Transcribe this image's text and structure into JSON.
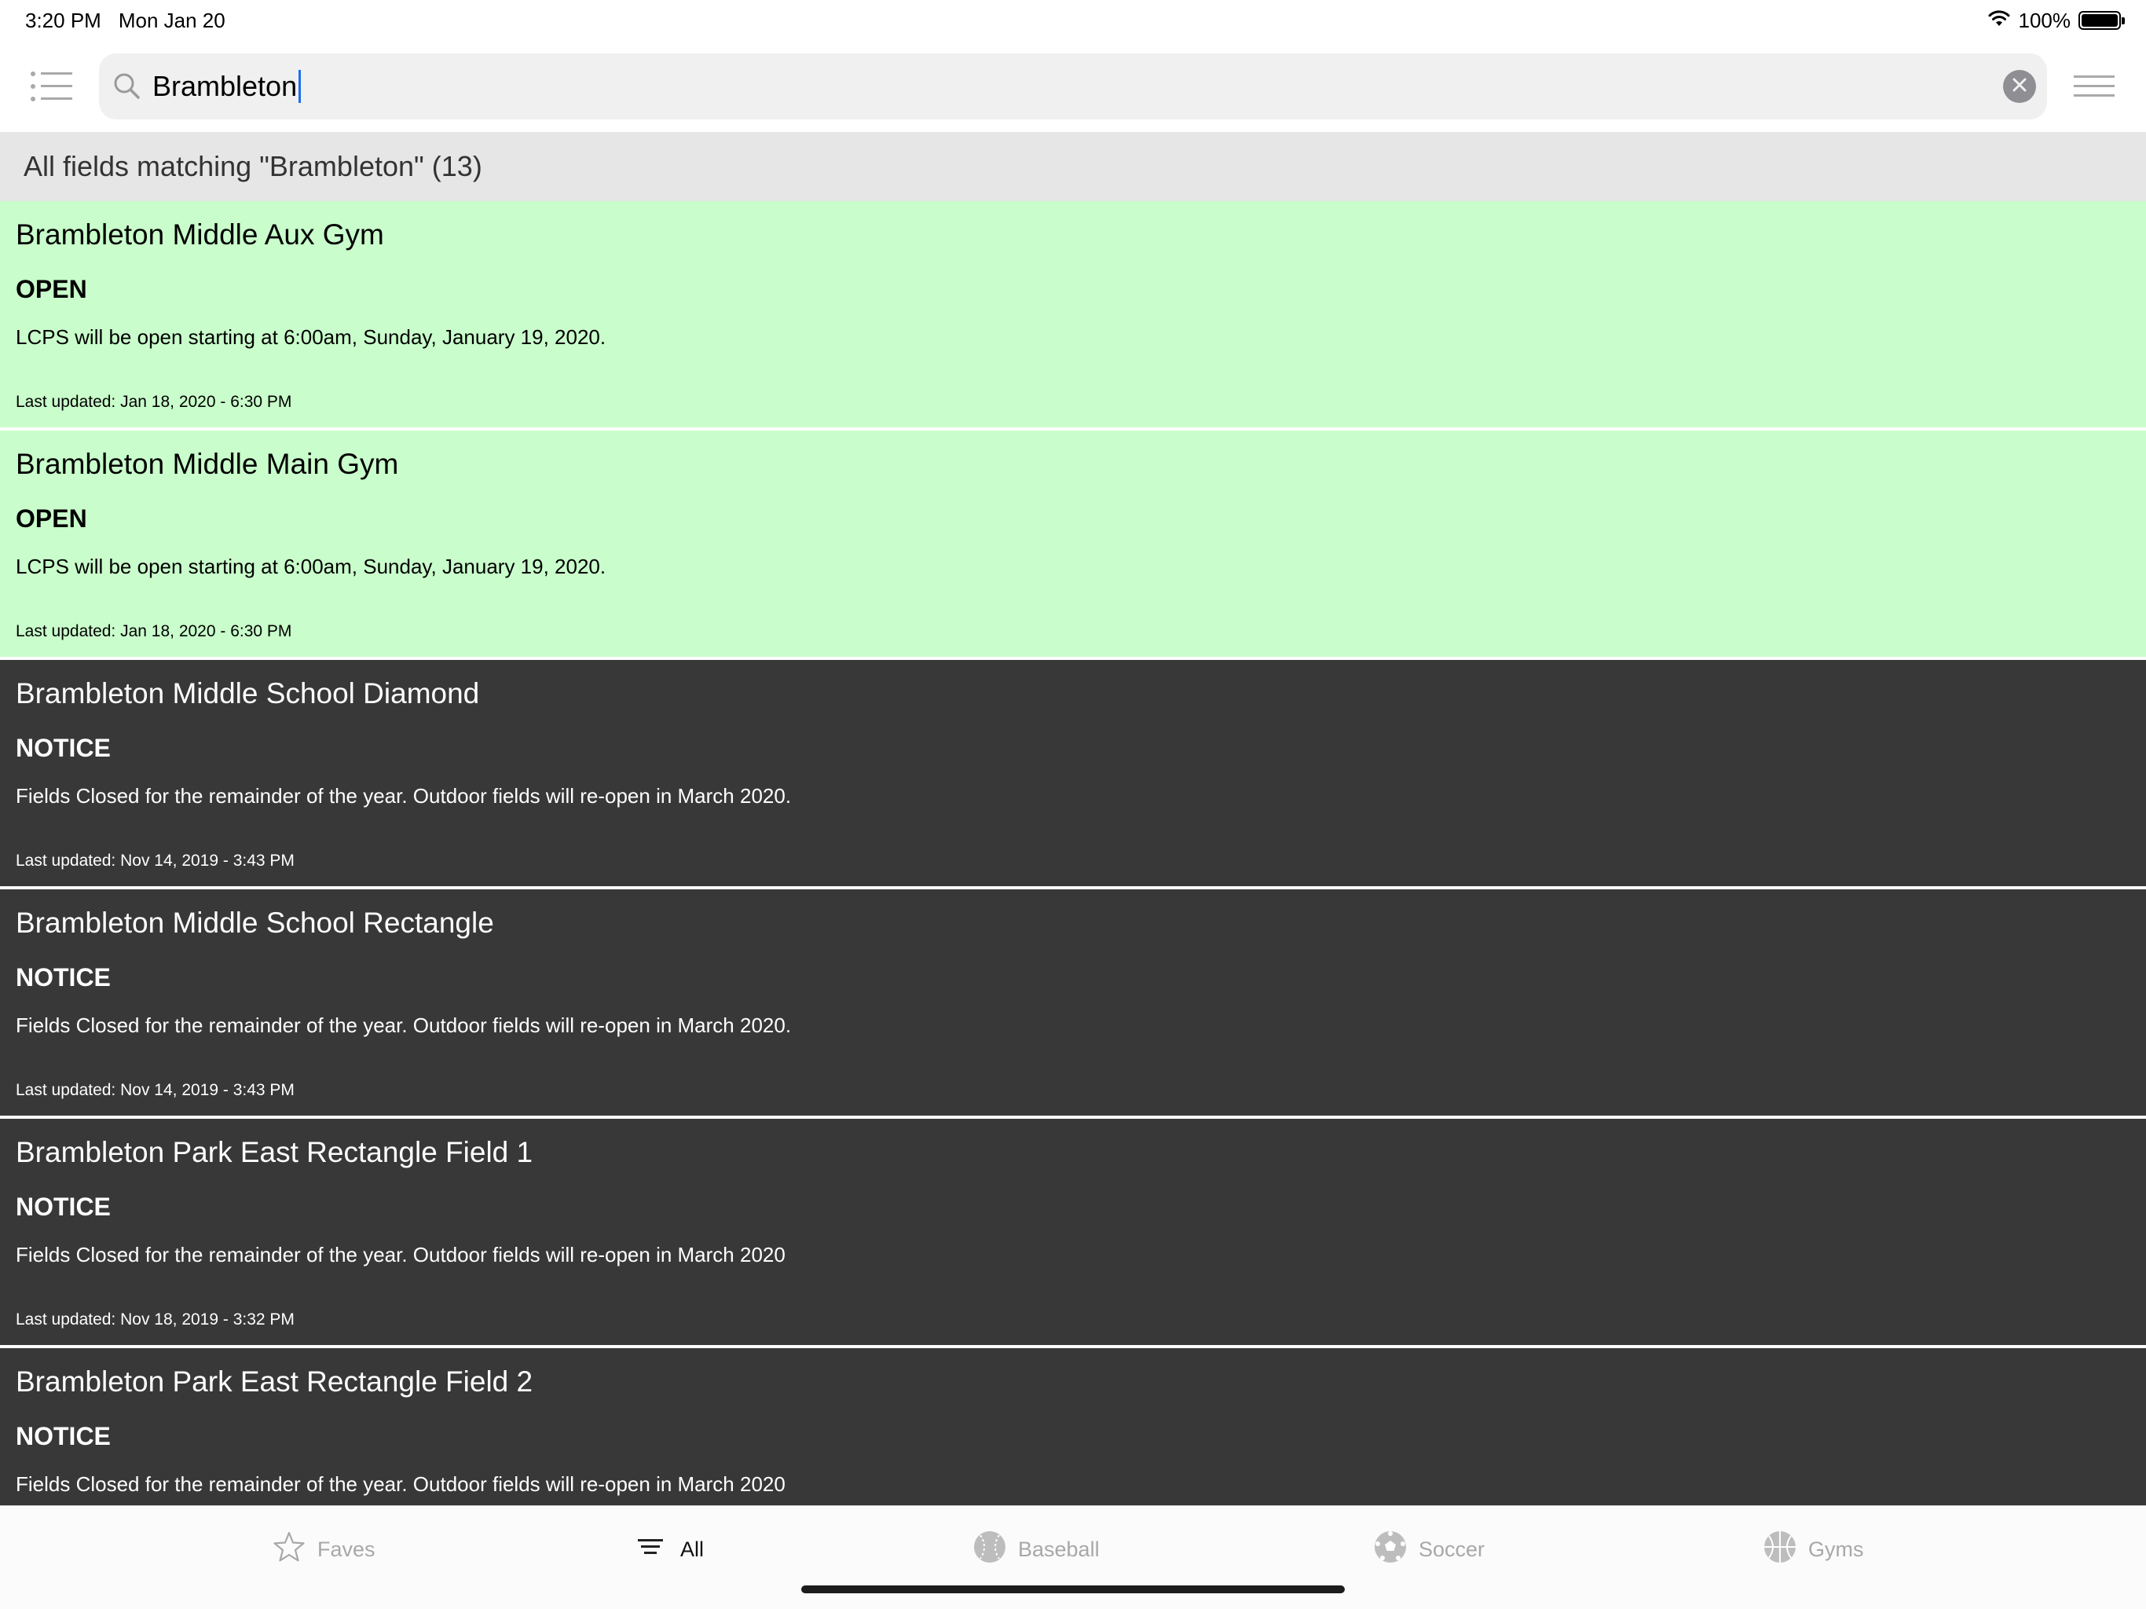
{
  "status_bar": {
    "time": "3:20 PM",
    "date": "Mon Jan 20",
    "battery": "100%",
    "battery_level": 1.0
  },
  "search": {
    "value": "Brambleton",
    "left_icon": "list-icon",
    "right_icon": "menu-icon"
  },
  "section": {
    "title": "All fields matching \"Brambleton\" (13)"
  },
  "colors": {
    "open_bg": "#c9fdcb",
    "notice_bg": "#383838",
    "accent_caret": "#1a6ff0"
  },
  "fields": [
    {
      "name": "Brambleton Middle Aux Gym",
      "status": "OPEN",
      "message": "LCPS will be open starting at 6:00am, Sunday, January 19, 2020.",
      "updated": "Last updated: Jan 18, 2020 - 6:30 PM"
    },
    {
      "name": "Brambleton Middle Main Gym",
      "status": "OPEN",
      "message": "LCPS will be open starting at 6:00am, Sunday, January 19, 2020.",
      "updated": "Last updated: Jan 18, 2020 - 6:30 PM"
    },
    {
      "name": "Brambleton Middle School Diamond",
      "status": "NOTICE",
      "message": "Fields Closed for the remainder of the year. Outdoor fields will re-open in March 2020.",
      "updated": "Last updated: Nov 14, 2019 - 3:43 PM"
    },
    {
      "name": "Brambleton Middle School Rectangle",
      "status": "NOTICE",
      "message": "Fields Closed for the remainder of the year. Outdoor fields will re-open in March 2020.",
      "updated": "Last updated: Nov 14, 2019 - 3:43 PM"
    },
    {
      "name": "Brambleton Park East Rectangle Field 1",
      "status": "NOTICE",
      "message": "Fields Closed for the remainder of the year. Outdoor fields will re-open in March 2020",
      "updated": "Last updated: Nov 18, 2019 - 3:32 PM"
    },
    {
      "name": "Brambleton Park East Rectangle Field 2",
      "status": "NOTICE",
      "message": "Fields Closed for the remainder of the year. Outdoor fields will re-open in March 2020",
      "updated": ""
    }
  ],
  "tabs": [
    {
      "label": "Faves",
      "icon": "star-icon",
      "active": false
    },
    {
      "label": "All",
      "icon": "filter-lines-icon",
      "active": true
    },
    {
      "label": "Baseball",
      "icon": "baseball-icon",
      "active": false
    },
    {
      "label": "Soccer",
      "icon": "soccer-ball-icon",
      "active": false
    },
    {
      "label": "Gyms",
      "icon": "basketball-icon",
      "active": false
    }
  ]
}
